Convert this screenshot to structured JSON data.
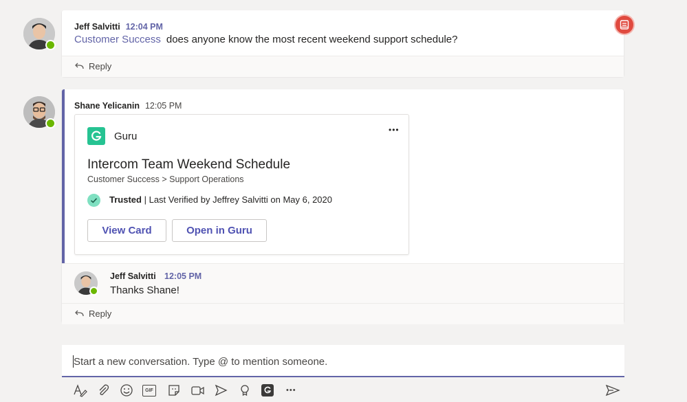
{
  "thread": {
    "first_message": {
      "author": "Jeff Salvitti",
      "time": "12:04 PM",
      "mention": "Customer Success",
      "text": "does anyone know the most recent weekend support schedule?",
      "reply_label": "Reply"
    },
    "second_message": {
      "author": "Shane Yelicanin",
      "time": "12:05 PM",
      "guru_card": {
        "app_name": "Guru",
        "more_label": "•••",
        "title": "Intercom Team Weekend Schedule",
        "path": "Customer Success > Support Operations",
        "trust_status": "Trusted",
        "verification_text": "| Last Verified by Jeffrey Salvitti on May 6, 2020",
        "view_button": "View Card",
        "open_button": "Open in Guru"
      }
    },
    "reply_message": {
      "author": "Jeff Salvitti",
      "time": "12:05 PM",
      "text": "Thanks Shane!",
      "reply_label": "Reply"
    }
  },
  "compose": {
    "placeholder": "Start a new conversation. Type @ to mention someone."
  },
  "toolbar": {
    "icons": [
      "format-icon",
      "attach-icon",
      "emoji-icon",
      "gif-icon",
      "sticker-icon",
      "meet-now-icon",
      "stream-icon",
      "praise-icon",
      "guru-icon",
      "more-icon",
      "send-icon"
    ],
    "gif_label": "GIF",
    "more_label": "•••"
  },
  "colors": {
    "accent": "#6264a7",
    "presence": "#6bb700",
    "guru_green": "#26c392",
    "notification_red": "#e04a3f"
  }
}
